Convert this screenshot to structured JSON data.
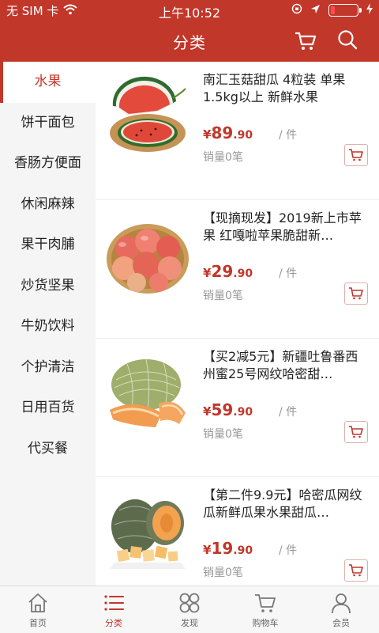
{
  "status": {
    "carrier": "无 SIM 卡",
    "time": "上午10:52"
  },
  "header": {
    "title": "分类"
  },
  "sidebar": {
    "items": [
      {
        "label": "水果",
        "active": true
      },
      {
        "label": "饼干面包"
      },
      {
        "label": "香肠方便面"
      },
      {
        "label": "休闲麻辣"
      },
      {
        "label": "果干肉脯"
      },
      {
        "label": "炒货坚果"
      },
      {
        "label": "牛奶饮料"
      },
      {
        "label": "个护清洁"
      },
      {
        "label": "日用百货"
      },
      {
        "label": "代买餐"
      }
    ]
  },
  "products": [
    {
      "name": "南汇玉菇甜瓜 4粒装 单果1.5kg以上 新鲜水果",
      "currency": "¥",
      "price_int": "89",
      "price_dec": ".90",
      "unit": "/ 件",
      "sales": "销量0笔",
      "image": "watermelon"
    },
    {
      "name": "【现摘现发】2019新上市苹果 红嘎啦苹果脆甜新…",
      "currency": "¥",
      "price_int": "29",
      "price_dec": ".90",
      "unit": "/ 件",
      "sales": "销量0笔",
      "image": "apples"
    },
    {
      "name": "【买2减5元】新疆吐鲁番西州蜜25号网纹哈密甜…",
      "currency": "¥",
      "price_int": "59",
      "price_dec": ".90",
      "unit": "/ 件",
      "sales": "销量0笔",
      "image": "cantaloupe"
    },
    {
      "name": "【第二件9.9元】哈密瓜网纹瓜新鲜瓜果水果甜瓜…",
      "currency": "¥",
      "price_int": "19",
      "price_dec": ".90",
      "unit": "/ 件",
      "sales": "销量0笔",
      "image": "hami-melon"
    }
  ],
  "tabbar": {
    "items": [
      {
        "label": "首页",
        "icon": "home-icon"
      },
      {
        "label": "分类",
        "icon": "list-icon",
        "active": true
      },
      {
        "label": "发现",
        "icon": "discover-icon"
      },
      {
        "label": "购物车",
        "icon": "cart-icon"
      },
      {
        "label": "会员",
        "icon": "user-icon"
      }
    ]
  },
  "colors": {
    "brand": "#c1372a",
    "sidebar_bg": "#f5f5f5",
    "muted_text": "#999999"
  }
}
